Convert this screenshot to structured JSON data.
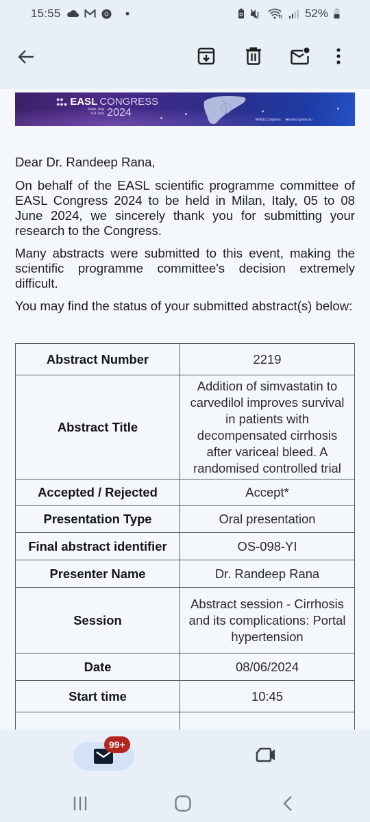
{
  "status_bar": {
    "time": "15:55",
    "left_icons": [
      "cloud-icon",
      "gmail-icon",
      "chrome-icon",
      "dot-icon"
    ],
    "right_icons": [
      "battery-saver-icon",
      "mute-icon",
      "wifi-icon",
      "signal-icon"
    ],
    "battery": "52%"
  },
  "toolbar": {
    "back": "back-arrow-icon",
    "actions": [
      "archive-icon",
      "delete-icon",
      "mark-unread-icon",
      "more-vert-icon"
    ]
  },
  "banner": {
    "brand": "EASL",
    "event": "CONGRESS",
    "location": "Milan, Italy",
    "dates": "5-8 June",
    "year": "2024",
    "hashtag": "#EASLCongress",
    "website": "easlcongress.eu"
  },
  "email": {
    "greeting": "Dear Dr. Randeep Rana,",
    "paragraphs": [
      "On behalf of the EASL scientific programme committee of EASL Congress 2024 to be held in Milan, Italy, 05 to 08 June 2024, we sincerely thank you for submitting your research to the Congress.",
      "Many abstracts were submitted to this event, making the scientific programme committee's decision extremely difficult.",
      "You may find the status of your submitted abstract(s) below:"
    ],
    "table": [
      {
        "key": "Abstract Number",
        "value": "2219"
      },
      {
        "key": "Abstract Title",
        "value": "Addition of simvastatin to carvedilol improves survival in patients with decompensated cirrhosis after variceal bleed. A randomised controlled trial"
      },
      {
        "key": "Accepted / Rejected",
        "value": "Accept*"
      },
      {
        "key": "Presentation Type",
        "value": "Oral presentation"
      },
      {
        "key": "Final abstract identifier",
        "value": "OS-098-YI"
      },
      {
        "key": "Presenter Name",
        "value": "Dr. Randeep Rana"
      },
      {
        "key": "Session",
        "value": "Abstract session - Cirrhosis and its complications: Portal hypertension"
      },
      {
        "key": "Date",
        "value": "08/06/2024"
      },
      {
        "key": "Start time",
        "value": "10:45"
      }
    ]
  },
  "bottom_nav": {
    "mail_badge": "99+",
    "items": [
      "mail-icon",
      "meet-icon"
    ]
  },
  "system_nav": [
    "recents-icon",
    "home-icon",
    "back-icon"
  ],
  "colors": {
    "app_bg": "#e9eff7",
    "content_bg": "#f4f8fc",
    "badge": "#b3261e",
    "pill": "#d3e3f5"
  }
}
